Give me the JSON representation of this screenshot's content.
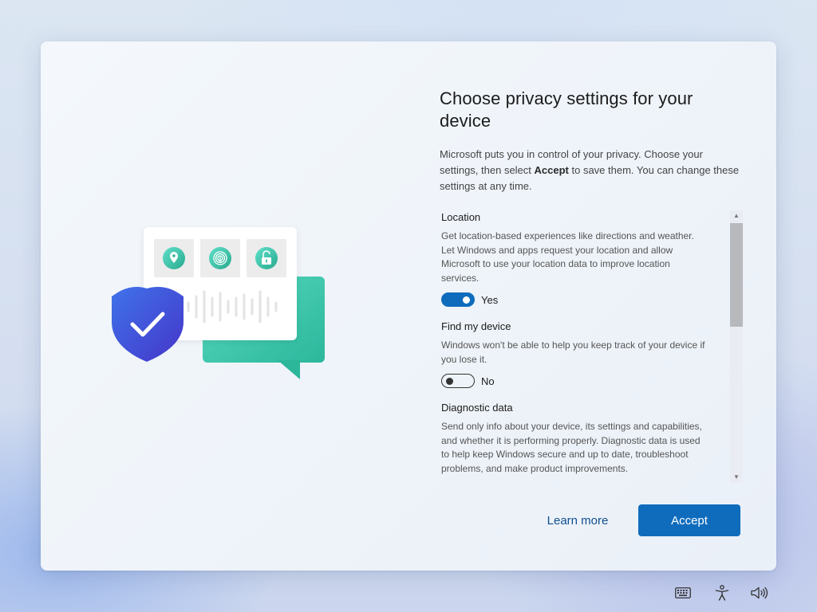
{
  "heading": {
    "title": "Choose privacy settings for your device",
    "intro_before": "Microsoft puts you in control of your privacy. Choose your settings, then select ",
    "intro_bold": "Accept",
    "intro_after": " to save them. You can change these settings at any time."
  },
  "settings": [
    {
      "title": "Location",
      "description": "Get location-based experiences like directions and weather. Let Windows and apps request your location and allow Microsoft to use your location data to improve location services.",
      "toggle_state": "on",
      "toggle_label": "Yes"
    },
    {
      "title": "Find my device",
      "description": "Windows won't be able to help you keep track of your device if you lose it.",
      "toggle_state": "off",
      "toggle_label": "No"
    },
    {
      "title": "Diagnostic data",
      "description": "Send only info about your device, its settings and capabilities, and whether it is performing properly. Diagnostic data is used to help keep Windows secure and up to date, troubleshoot problems, and make product improvements."
    }
  ],
  "buttons": {
    "learn_more": "Learn more",
    "accept": "Accept"
  },
  "tray": {
    "icons": [
      "keyboard-icon",
      "accessibility-icon",
      "volume-icon"
    ]
  },
  "colors": {
    "accent": "#0f6cbd",
    "shield_blue": "#3d5fe0",
    "bubble_teal": "#3ec9ad"
  }
}
